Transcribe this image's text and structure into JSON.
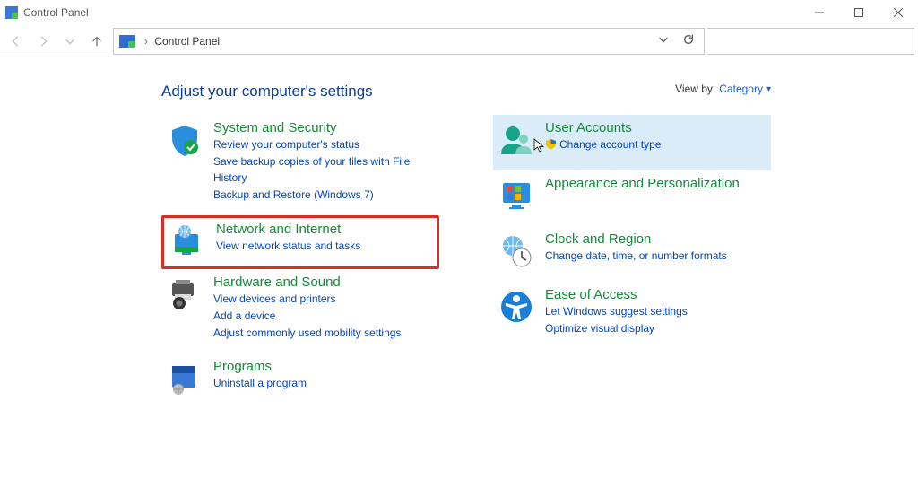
{
  "window": {
    "title": "Control Panel"
  },
  "address": {
    "breadcrumb": "Control Panel"
  },
  "content": {
    "heading": "Adjust your computer's settings",
    "viewby_label": "View by:",
    "viewby_value": "Category"
  },
  "left_col": [
    {
      "id": "system-security",
      "title": "System and Security",
      "links": [
        "Review your computer's status",
        "Save backup copies of your files with File History",
        "Backup and Restore (Windows 7)"
      ]
    },
    {
      "id": "network-internet",
      "title": "Network and Internet",
      "links": [
        "View network status and tasks"
      ],
      "highlight": "red"
    },
    {
      "id": "hardware-sound",
      "title": "Hardware and Sound",
      "links": [
        "View devices and printers",
        "Add a device",
        "Adjust commonly used mobility settings"
      ]
    },
    {
      "id": "programs",
      "title": "Programs",
      "links": [
        "Uninstall a program"
      ]
    }
  ],
  "right_col": [
    {
      "id": "user-accounts",
      "title": "User Accounts",
      "links": [
        "Change account type"
      ],
      "link_prefix_shield": true,
      "highlight": "blue",
      "cursor": true
    },
    {
      "id": "appearance-personalization",
      "title": "Appearance and Personalization",
      "links": []
    },
    {
      "id": "clock-region",
      "title": "Clock and Region",
      "links": [
        "Change date, time, or number formats"
      ]
    },
    {
      "id": "ease-of-access",
      "title": "Ease of Access",
      "links": [
        "Let Windows suggest settings",
        "Optimize visual display"
      ]
    }
  ]
}
